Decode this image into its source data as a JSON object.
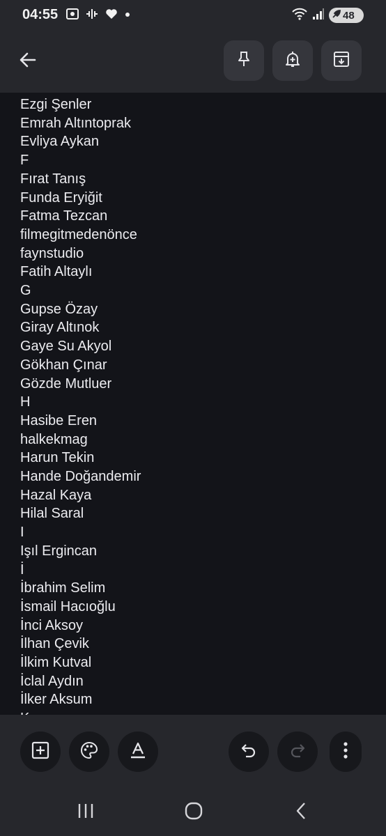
{
  "status_bar": {
    "time": "04:55",
    "left_icons": [
      "screenshot-icon",
      "voice-waveform-icon",
      "heart-icon",
      "dot-icon"
    ],
    "right_icons": [
      "wifi-icon",
      "signal-icon"
    ],
    "battery_level": "48"
  },
  "app_bar": {
    "back_icon": "arrow-left-icon",
    "actions": [
      "pin-icon",
      "add-reminder-icon",
      "archive-icon"
    ]
  },
  "note": {
    "lines": [
      "Ezgi Şenler",
      "Emrah Altıntoprak",
      "Evliya Aykan",
      "F",
      "Fırat Tanış",
      "Funda Eryiğit",
      "Fatma Tezcan",
      "filmegitmedenönce",
      "faynstudio",
      "Fatih Altaylı",
      "G",
      "Gupse Özay",
      "Giray Altınok",
      "Gaye Su Akyol",
      "Gökhan Çınar",
      "Gözde Mutluer",
      "H",
      "Hasibe Eren",
      "halkekmag",
      "Harun Tekin",
      "Hande Doğandemir",
      "Hazal Kaya",
      "Hilal Saral",
      "I",
      "Işıl Ergincan",
      "İ",
      "İbrahim Selim",
      "İsmail Hacıoğlu",
      "İnci Aksoy",
      "İlhan Çevik",
      "İlkim Kutval",
      "İclal Aydın",
      "İlker Aksum",
      "K"
    ]
  },
  "bottom_toolbar": {
    "left_tools": [
      "add-box-icon",
      "palette-icon",
      "text-format-icon"
    ],
    "right_tools": [
      "undo-icon",
      "redo-icon",
      "more-vertical-icon"
    ]
  },
  "nav_bar": {
    "buttons": [
      "recent-apps-icon",
      "home-icon",
      "back-nav-icon"
    ]
  },
  "colors": {
    "background": "#131419",
    "bars": "#26272c",
    "text": "#ececf0"
  }
}
